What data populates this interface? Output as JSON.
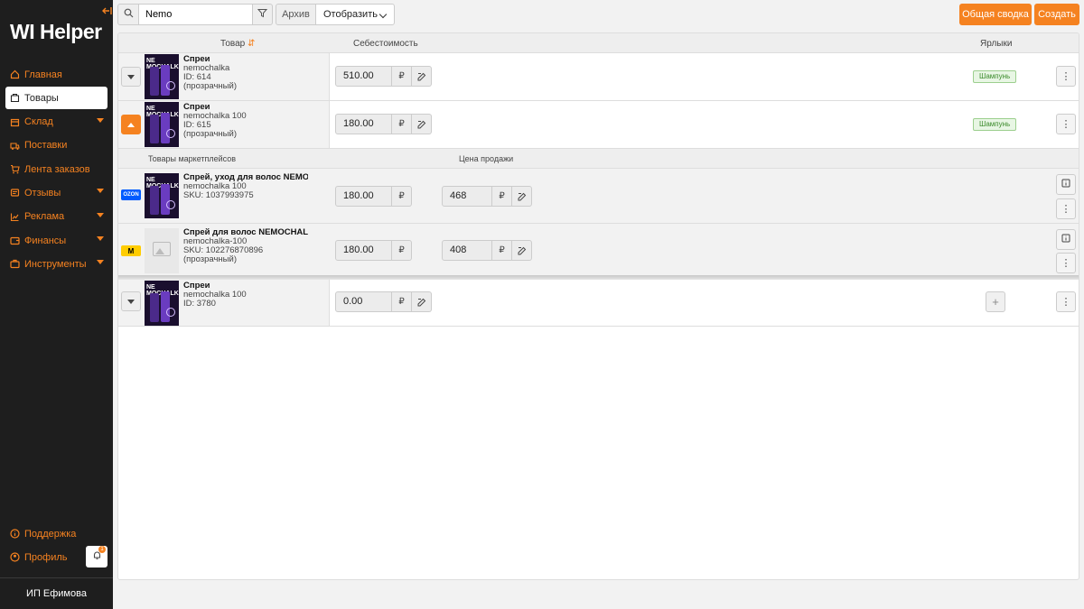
{
  "sidebar": {
    "logo": "WI Helper",
    "items": [
      {
        "label": "Главная",
        "icon": "home-icon",
        "active": false,
        "chevron": false
      },
      {
        "label": "Товары",
        "icon": "box-icon",
        "active": true,
        "chevron": false
      },
      {
        "label": "Склад",
        "icon": "warehouse-icon",
        "active": false,
        "chevron": true
      },
      {
        "label": "Поставки",
        "icon": "truck-icon",
        "active": false,
        "chevron": false
      },
      {
        "label": "Лента заказов",
        "icon": "cart-icon",
        "active": false,
        "chevron": false
      },
      {
        "label": "Отзывы",
        "icon": "reviews-icon",
        "active": false,
        "chevron": true
      },
      {
        "label": "Реклама",
        "icon": "chart-icon",
        "active": false,
        "chevron": true
      },
      {
        "label": "Финансы",
        "icon": "wallet-icon",
        "active": false,
        "chevron": true
      },
      {
        "label": "Инструменты",
        "icon": "tools-icon",
        "active": false,
        "chevron": true
      }
    ],
    "support": "Поддержка",
    "profile": "Профиль",
    "notif_count": "1",
    "company": "ИП Ефимова"
  },
  "toolbar": {
    "search_value": "Nemo",
    "archive_label": "Архив",
    "show_label": "Отобразить",
    "summary_label": "Общая сводка",
    "create_label": "Создать"
  },
  "table": {
    "col_product": "Товар",
    "col_cost": "Себестоимость",
    "col_tags": "Ярлыки",
    "sub_marketplace": "Товары маркетплейсов",
    "sub_price": "Цена продажи",
    "currency": "₽",
    "rows": [
      {
        "name": "Спреи",
        "brand": "nemochalka",
        "id": "ID: 614",
        "extra": "(прозрачный)",
        "cost": "510.00",
        "tag": "Шампунь"
      },
      {
        "name": "Спреи",
        "brand": "nemochalka 100",
        "id": "ID: 615",
        "extra": "(прозрачный)",
        "cost": "180.00",
        "tag": "Шампунь"
      },
      {
        "name": "Спреи",
        "brand": "nemochalka 100",
        "id": "ID: 3780",
        "extra": "",
        "cost": "0.00",
        "tag": ""
      }
    ],
    "sub_rows": [
      {
        "marketplace": "OZON",
        "name": "Спрей, уход для волос NEMOCHALKA",
        "brand": "nemochalka 100",
        "sku": "SKU: 1037993975",
        "extra": "",
        "cost": "180.00",
        "price": "468"
      },
      {
        "marketplace": "Yandex Market",
        "name": "Спрей для волос NEMOCHALKA",
        "brand": "nemochalka-100",
        "sku": "SKU: 102276870896",
        "extra": "(прозрачный)",
        "cost": "180.00",
        "price": "408"
      }
    ],
    "thumb_text": "NE MOCHALKA"
  },
  "colors": {
    "accent": "#f58220",
    "sidebar_bg": "#1e1e1e",
    "tag_green": "#3a8a2a",
    "ozon": "#005bff",
    "yandex": "#ffcc00"
  }
}
